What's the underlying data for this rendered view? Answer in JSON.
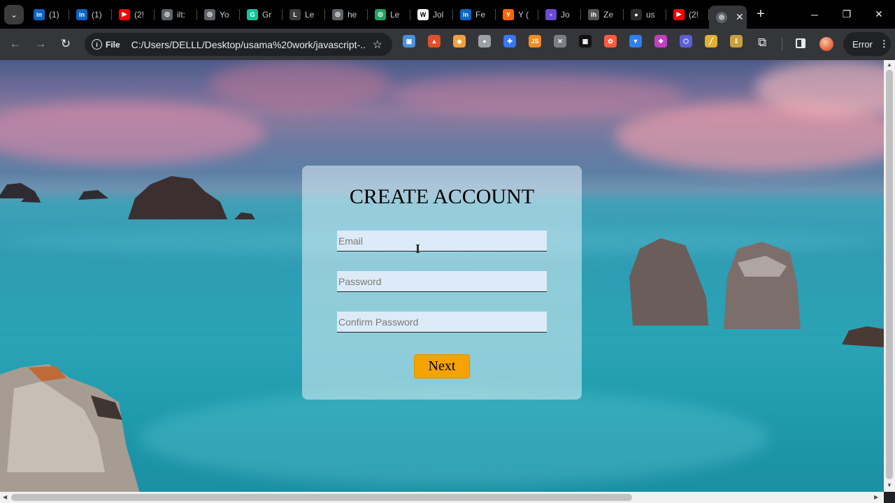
{
  "browser": {
    "tabs": [
      {
        "title": "(1)",
        "icon": "linkedin-icon",
        "color": "#0a66c2",
        "glyph": "in"
      },
      {
        "title": "(1)",
        "icon": "linkedin-icon",
        "color": "#0a66c2",
        "glyph": "in"
      },
      {
        "title": "(2!",
        "icon": "youtube-icon",
        "color": "#ff0000",
        "glyph": "▶"
      },
      {
        "title": "ilt:",
        "icon": "globe-icon",
        "color": "#5f6368",
        "glyph": "◎"
      },
      {
        "title": "Yo",
        "icon": "globe-icon",
        "color": "#5f6368",
        "glyph": "◎"
      },
      {
        "title": "Gr",
        "icon": "grammarly-icon",
        "color": "#15c39a",
        "glyph": "G"
      },
      {
        "title": "Le",
        "icon": "leetcode-icon",
        "color": "#3c3c3c",
        "glyph": "L"
      },
      {
        "title": "he",
        "icon": "globe-icon",
        "color": "#5f6368",
        "glyph": "◎"
      },
      {
        "title": "Le",
        "icon": "globe-icon",
        "color": "#1ea362",
        "glyph": "◎"
      },
      {
        "title": "Jol",
        "icon": "w-icon",
        "color": "#ffffff",
        "glyph": "W"
      },
      {
        "title": "Fe",
        "icon": "linkedin-icon",
        "color": "#0a66c2",
        "glyph": "in"
      },
      {
        "title": "Y (",
        "icon": "ycombinator-icon",
        "color": "#ff6600",
        "glyph": "Y"
      },
      {
        "title": "Jo",
        "icon": "stethoscope-icon",
        "color": "#6b4bd6",
        "glyph": "♆"
      },
      {
        "title": "Ze",
        "icon": "ih-icon",
        "color": "#555555",
        "glyph": "ih"
      },
      {
        "title": "us",
        "icon": "github-icon",
        "color": "#2b2b2b",
        "glyph": "●"
      },
      {
        "title": "(2!",
        "icon": "youtube-icon",
        "color": "#ff0000",
        "glyph": "▶"
      }
    ],
    "url": "C:/Users/DELLL/Desktop/usama%20work/javascript-...",
    "scheme_label": "File",
    "profile_error_label": "Error",
    "extensions": [
      {
        "name": "ext-1",
        "color": "#4a90d9",
        "glyph": "▣"
      },
      {
        "name": "ext-2",
        "color": "#e0502a",
        "glyph": "▲"
      },
      {
        "name": "ext-3",
        "color": "#f0a040",
        "glyph": "◆"
      },
      {
        "name": "ext-4",
        "color": "#9aa0a6",
        "glyph": "●"
      },
      {
        "name": "ext-5",
        "color": "#3478f6",
        "glyph": "✚"
      },
      {
        "name": "ext-6",
        "color": "#f08a24",
        "glyph": "JS"
      },
      {
        "name": "ext-7",
        "color": "#7a7f85",
        "glyph": "✕"
      },
      {
        "name": "ext-8",
        "color": "#111111",
        "glyph": "▦"
      },
      {
        "name": "ext-9",
        "color": "#ff5a3c",
        "glyph": "✿"
      },
      {
        "name": "ext-10",
        "color": "#2f80ed",
        "glyph": "▼"
      },
      {
        "name": "ext-11",
        "color": "#c040c0",
        "glyph": "❖"
      },
      {
        "name": "ext-12",
        "color": "#5a5fd6",
        "glyph": "⬡"
      },
      {
        "name": "ext-13",
        "color": "#e0b030",
        "glyph": "╱"
      },
      {
        "name": "ext-14",
        "color": "#c8a040",
        "glyph": "⇩"
      }
    ]
  },
  "form": {
    "title": "CREATE ACCOUNT",
    "email_placeholder": "Email",
    "password_placeholder": "Password",
    "confirm_placeholder": "Confirm Password",
    "next_label": "Next"
  },
  "colors": {
    "accent_button": "#f5a300"
  }
}
